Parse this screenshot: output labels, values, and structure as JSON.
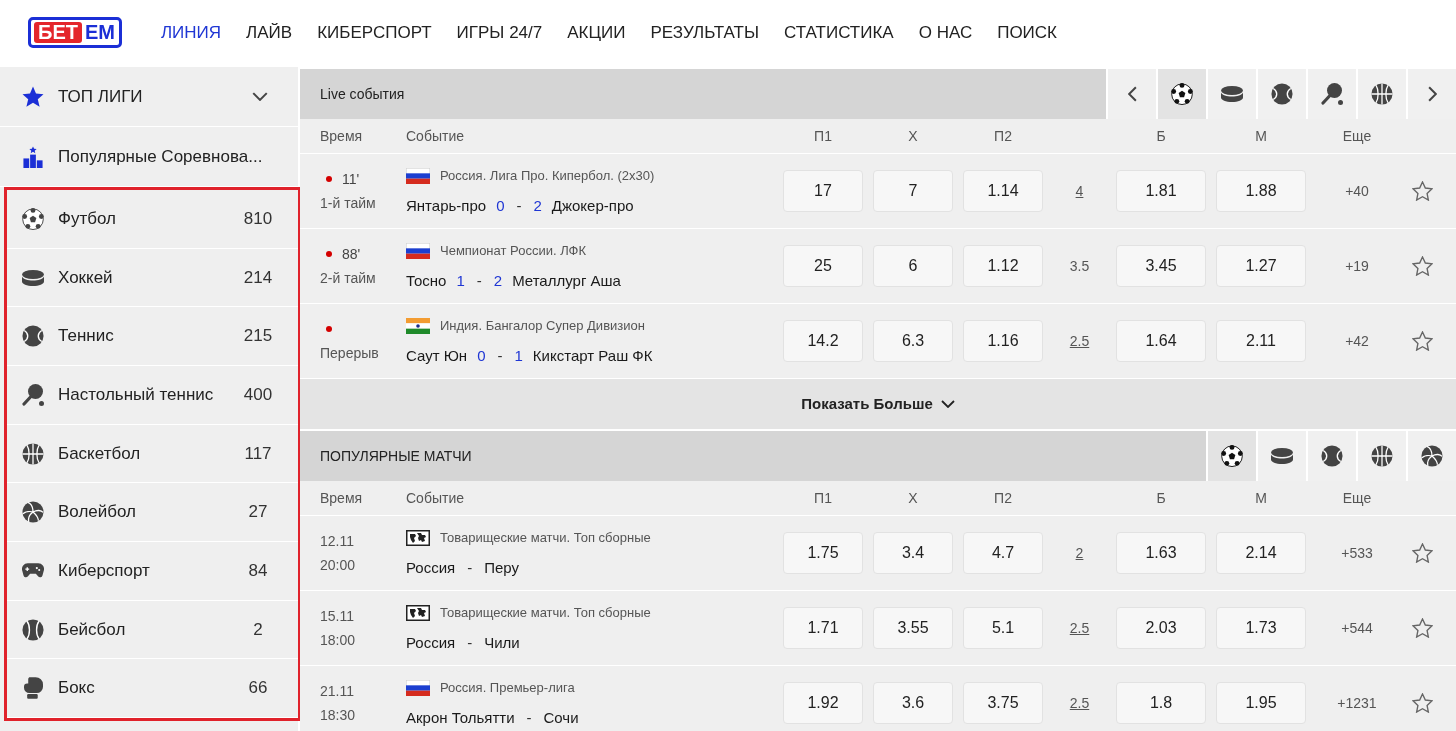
{
  "header": {
    "logo": {
      "red_part": "БЕТ",
      "blue_part": "ЕМ"
    },
    "nav": [
      {
        "label": "ЛИНИЯ",
        "selected": true
      },
      {
        "label": "ЛАЙВ",
        "selected": false
      },
      {
        "label": "КИБЕРСПОРТ",
        "selected": false
      },
      {
        "label": "ИГРЫ 24/7",
        "selected": false
      },
      {
        "label": "АКЦИИ",
        "selected": false
      },
      {
        "label": "РЕЗУЛЬТАТЫ",
        "selected": false
      },
      {
        "label": "СТАТИСТИКА",
        "selected": false
      },
      {
        "label": "О НАС",
        "selected": false
      },
      {
        "label": "ПОИСК",
        "selected": false
      }
    ]
  },
  "sidebar": {
    "top_leagues": {
      "label": "ТОП ЛИГИ",
      "expanded": false
    },
    "popular_competitions": {
      "label": "Популярные Соревнова..."
    },
    "sports_highlighted": true,
    "sports": [
      {
        "kind": "football",
        "label": "Футбол",
        "count": "810"
      },
      {
        "kind": "hockey",
        "label": "Хоккей",
        "count": "214"
      },
      {
        "kind": "tennis",
        "label": "Теннис",
        "count": "215"
      },
      {
        "kind": "table_tennis",
        "label": "Настольный теннис",
        "count": "400"
      },
      {
        "kind": "basketball",
        "label": "Баскетбол",
        "count": "117"
      },
      {
        "kind": "volleyball",
        "label": "Волейбол",
        "count": "27"
      },
      {
        "kind": "esports",
        "label": "Киберспорт",
        "count": "84"
      },
      {
        "kind": "baseball",
        "label": "Бейсбол",
        "count": "2"
      },
      {
        "kind": "boxing",
        "label": "Бокс",
        "count": "66"
      }
    ]
  },
  "live": {
    "title": "Live события",
    "arrows": true,
    "sport_tabs": [
      {
        "kind": "football",
        "selected": true
      },
      {
        "kind": "hockey",
        "selected": false
      },
      {
        "kind": "tennis",
        "selected": false
      },
      {
        "kind": "table_tennis",
        "selected": false
      },
      {
        "kind": "basketball",
        "selected": false
      }
    ],
    "columns": [
      "Время",
      "Событие",
      "П1",
      "Х",
      "П2",
      "Б",
      "М",
      "Еще"
    ],
    "rows": [
      {
        "live": true,
        "minute": "11'",
        "period": "1-й тайм",
        "flag": {
          "kind": "ru"
        },
        "league": "Россия. Лига Про. Кипербол. (2x30)",
        "match_line": [
          {
            "kind": "team",
            "text": "Янтарь-про"
          },
          {
            "kind": "score",
            "text": "0"
          },
          {
            "kind": "separator",
            "text": "-"
          },
          {
            "kind": "score",
            "text": "2"
          },
          {
            "kind": "team",
            "text": "Джокер-про"
          }
        ],
        "odds": [
          "17",
          "7",
          "1.14"
        ],
        "total": "4",
        "total_link": true,
        "over": "1.81",
        "under": "1.88",
        "more": "+40",
        "favorite": false
      },
      {
        "live": true,
        "minute": "88'",
        "period": "2-й тайм",
        "flag": {
          "kind": "ru"
        },
        "league": "Чемпионат России. ЛФК",
        "match_line": [
          {
            "kind": "team",
            "text": "Тосно"
          },
          {
            "kind": "score",
            "text": "1"
          },
          {
            "kind": "separator",
            "text": "-"
          },
          {
            "kind": "score",
            "text": "2"
          },
          {
            "kind": "team",
            "text": "Металлург Аша"
          }
        ],
        "odds": [
          "25",
          "6",
          "1.12"
        ],
        "total": "3.5",
        "total_link": false,
        "over": "3.45",
        "under": "1.27",
        "more": "+19",
        "favorite": false
      },
      {
        "live": true,
        "period": "Перерыв",
        "flag": {
          "kind": "in"
        },
        "league": "Индия. Бангалор Супер Дивизион",
        "match_line": [
          {
            "kind": "team",
            "text": "Саут Юн"
          },
          {
            "kind": "score",
            "text": "0"
          },
          {
            "kind": "separator",
            "text": "-"
          },
          {
            "kind": "score",
            "text": "1"
          },
          {
            "kind": "team",
            "text": "Кикстарт Раш ФК"
          }
        ],
        "odds": [
          "14.2",
          "6.3",
          "1.16"
        ],
        "total": "2.5",
        "total_link": true,
        "over": "1.64",
        "under": "2.11",
        "more": "+42",
        "favorite": false
      }
    ],
    "show_more": "Показать Больше"
  },
  "popular": {
    "title": "ПОПУЛЯРНЫЕ МАТЧИ",
    "sport_tabs": [
      {
        "kind": "football",
        "selected": true
      },
      {
        "kind": "hockey",
        "selected": false
      },
      {
        "kind": "tennis",
        "selected": false
      },
      {
        "kind": "basketball",
        "selected": false
      },
      {
        "kind": "volleyball",
        "selected": false
      }
    ],
    "columns": [
      "Время",
      "Событие",
      "П1",
      "Х",
      "П2",
      "Б",
      "М",
      "Еще"
    ],
    "rows": [
      {
        "date": "12.11",
        "time": "20:00",
        "flag": {
          "kind": "world"
        },
        "league": "Товарищеские матчи. Топ сборные",
        "match_line": [
          {
            "kind": "team",
            "text": "Россия"
          },
          {
            "kind": "separator",
            "text": "-"
          },
          {
            "kind": "team",
            "text": "Перу"
          }
        ],
        "odds": [
          "1.75",
          "3.4",
          "4.7"
        ],
        "total": "2",
        "total_link": true,
        "over": "1.63",
        "under": "2.14",
        "more": "+533",
        "favorite": false
      },
      {
        "date": "15.11",
        "time": "18:00",
        "flag": {
          "kind": "world"
        },
        "league": "Товарищеские матчи. Топ сборные",
        "match_line": [
          {
            "kind": "team",
            "text": "Россия"
          },
          {
            "kind": "separator",
            "text": "-"
          },
          {
            "kind": "team",
            "text": "Чили"
          }
        ],
        "odds": [
          "1.71",
          "3.55",
          "5.1"
        ],
        "total": "2.5",
        "total_link": true,
        "over": "2.03",
        "under": "1.73",
        "more": "+544",
        "favorite": false
      },
      {
        "date": "21.11",
        "time": "18:30",
        "flag": {
          "kind": "ru"
        },
        "league": "Россия. Премьер-лига",
        "match_line": [
          {
            "kind": "team",
            "text": "Акрон Тольятти"
          },
          {
            "kind": "separator",
            "text": "-"
          },
          {
            "kind": "team",
            "text": "Сочи"
          }
        ],
        "odds": [
          "1.92",
          "3.6",
          "3.75"
        ],
        "total": "2.5",
        "total_link": true,
        "over": "1.8",
        "under": "1.95",
        "more": "+1231",
        "favorite": false
      }
    ]
  }
}
